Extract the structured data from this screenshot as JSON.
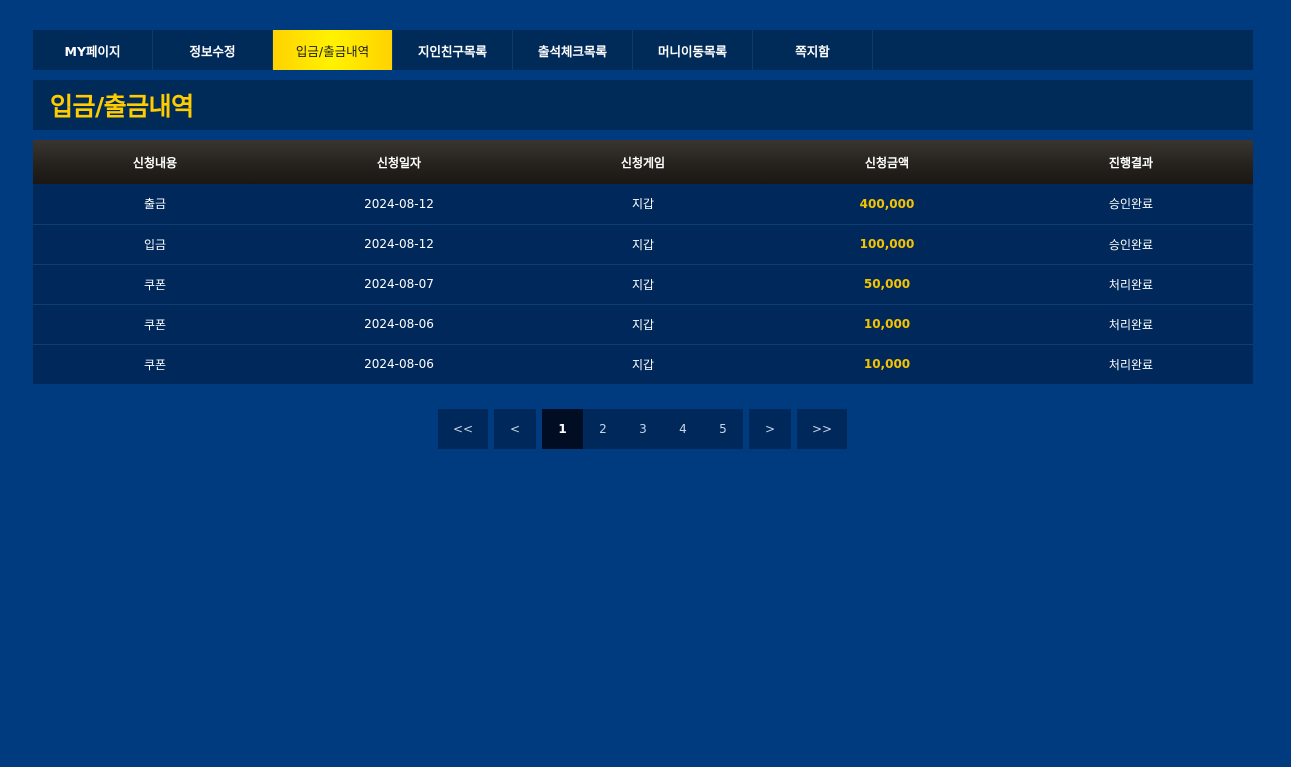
{
  "tabs": [
    {
      "label": "MY페이지"
    },
    {
      "label": "정보수정"
    },
    {
      "label": "입금/출금내역"
    },
    {
      "label": "지인친구목록"
    },
    {
      "label": "출석체크목록"
    },
    {
      "label": "머니이동목록"
    },
    {
      "label": "쪽지함"
    }
  ],
  "active_tab": 2,
  "page_title": "입금/출금내역",
  "table": {
    "headers": [
      "신청내용",
      "신청일자",
      "신청게임",
      "신청금액",
      "진행결과"
    ],
    "rows": [
      [
        "출금",
        "2024-08-12",
        "지갑",
        "400,000",
        "승인완료"
      ],
      [
        "입금",
        "2024-08-12",
        "지갑",
        "100,000",
        "승인완료"
      ],
      [
        "쿠폰",
        "2024-08-07",
        "지갑",
        "50,000",
        "처리완료"
      ],
      [
        "쿠폰",
        "2024-08-06",
        "지갑",
        "10,000",
        "처리완료"
      ],
      [
        "쿠폰",
        "2024-08-06",
        "지갑",
        "10,000",
        "처리완료"
      ]
    ]
  },
  "pagination": {
    "first": "<<",
    "prev": "<",
    "pages": [
      "1",
      "2",
      "3",
      "4",
      "5"
    ],
    "current": "1",
    "next": ">",
    "last": ">>"
  },
  "colors": {
    "background": "#003b80",
    "panel": "#002a58",
    "accent_yellow": "#ffcc00",
    "amount": "#f5c400"
  }
}
